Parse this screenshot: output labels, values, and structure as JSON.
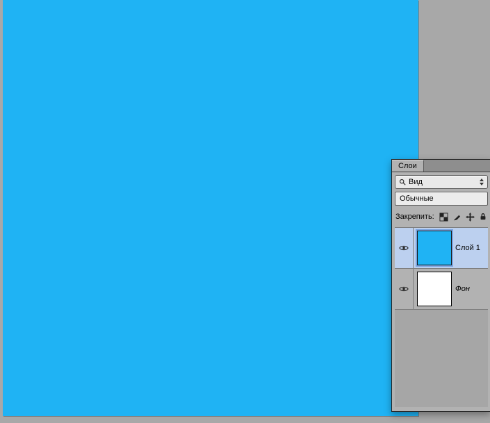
{
  "workspace": {
    "background_color": "#a8a8a8"
  },
  "canvas": {
    "fill_color": "#1fb3f4"
  },
  "layers_panel": {
    "tab_label": "Слои",
    "filter_kind_label": "Вид",
    "blend_mode_label": "Обычные",
    "lock_label": "Закрепить:",
    "layers": [
      {
        "name": "Слой 1",
        "visible": true,
        "selected": true,
        "thumb_color": "#1fb3f4",
        "italic": false
      },
      {
        "name": "Фон",
        "visible": true,
        "selected": false,
        "thumb_color": "#ffffff",
        "italic": true
      }
    ],
    "lock_icons": {
      "pixels": "lock-pixels-icon",
      "brush": "lock-brush-icon",
      "position": "lock-position-icon",
      "all": "lock-all-icon"
    }
  }
}
